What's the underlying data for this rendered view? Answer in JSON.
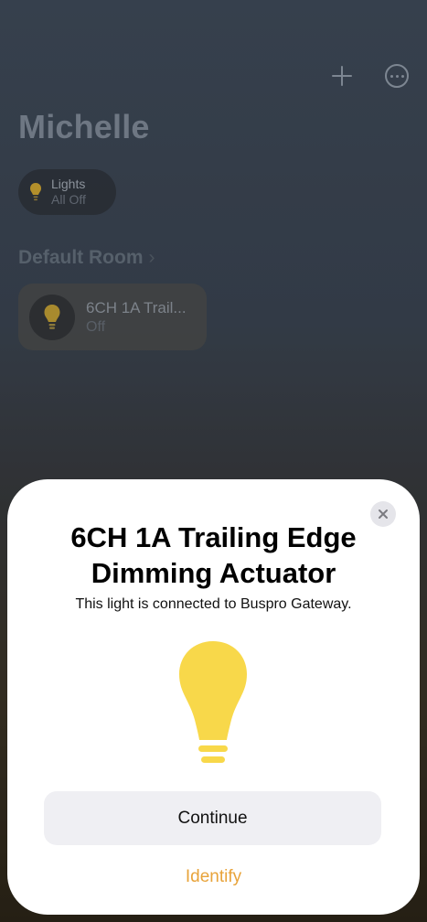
{
  "home": {
    "title": "Michelle",
    "lights_chip": {
      "label": "Lights",
      "status": "All Off"
    },
    "room": {
      "name": "Default Room",
      "chevron": "›"
    },
    "accessory": {
      "name": "6CH 1A Trail...",
      "state": "Off",
      "icon": "bulb-icon"
    },
    "toolbar": {
      "add_icon": "plus-icon",
      "more_icon": "ellipsis-circle-icon"
    }
  },
  "sheet": {
    "title": "6CH 1A Trailing Edge Dimming Actuator",
    "subtitle": "This light is connected to Buspro Gateway.",
    "continue_label": "Continue",
    "identify_label": "Identify",
    "close_icon": "close-icon",
    "hero_icon": "lightbulb-icon"
  },
  "colors": {
    "bulb_yellow": "#F8D84A",
    "accent_orange": "#E8A33A",
    "button_bg": "#EFEFF3"
  }
}
